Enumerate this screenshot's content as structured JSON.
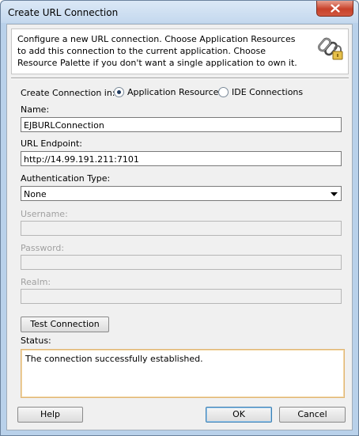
{
  "window": {
    "title": "Create URL Connection"
  },
  "header": {
    "description": "Configure a new URL connection.  Choose Application Resources to add this connection to the current application. Choose Resource Palette if you don't want a single application to own it.",
    "icon": "chain-link-lock-icon"
  },
  "form": {
    "create_in_label": "Create Connection in:",
    "options": [
      {
        "label": "Application Resources",
        "selected": true
      },
      {
        "label": "IDE Connections",
        "selected": false
      }
    ],
    "name_label": "Name:",
    "name_value": "EJBURLConnection",
    "url_label": "URL Endpoint:",
    "url_value": "http://14.99.191.211:7101",
    "auth_label": "Authentication Type:",
    "auth_value": "None",
    "username_label": "Username:",
    "username_value": "",
    "password_label": "Password:",
    "password_value": "",
    "realm_label": "Realm:",
    "realm_value": "",
    "test_button": "Test Connection",
    "status_label": "Status:",
    "status_text": "The connection successfully established."
  },
  "footer": {
    "help": "Help",
    "ok": "OK",
    "cancel": "Cancel"
  },
  "colors": {
    "accent_border": "#e0b676",
    "default_button": "#3c7fb1"
  }
}
